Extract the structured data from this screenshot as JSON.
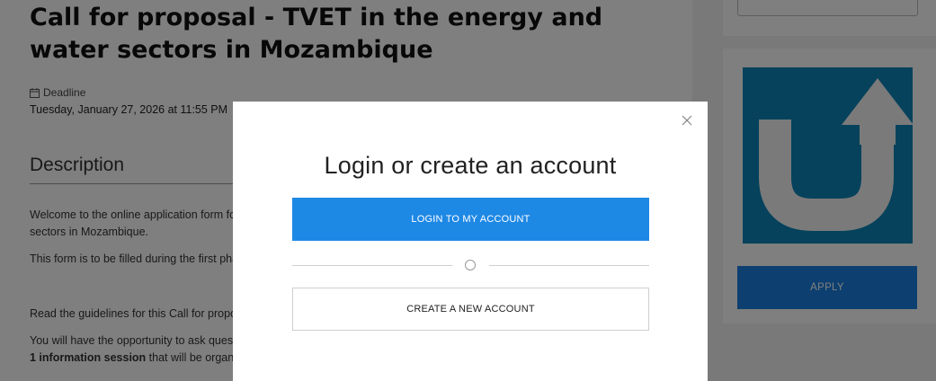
{
  "page": {
    "title": "Call for proposal - TVET in the energy and water sectors in Mozambique",
    "deadline_label": "Deadline",
    "deadline_value": "Tuesday, January 27, 2026 at 11:55 PM",
    "description_heading": "Description",
    "paragraphs": [
      "Welcome to the online application form for the call for proposals TVET in the energy and water\nsectors in Mozambique.",
      "This form is to be filled during the first phase of the call for proposals.",
      "Read the guidelines for this Call for proposals carefully.",
      "You will have the opportunity to ask questions during"
    ],
    "info_session_bold": "1 information session",
    "info_session_rest": " that will be organized online."
  },
  "sidebar": {
    "apply_label": "APPLY",
    "logo_bg": "#0c85b9"
  },
  "modal": {
    "title": "Login or create an account",
    "login_label": "LOGIN TO MY ACCOUNT",
    "create_label": "CREATE A NEW ACCOUNT",
    "close_icon": "close-icon",
    "accent": "#1e88e5"
  }
}
